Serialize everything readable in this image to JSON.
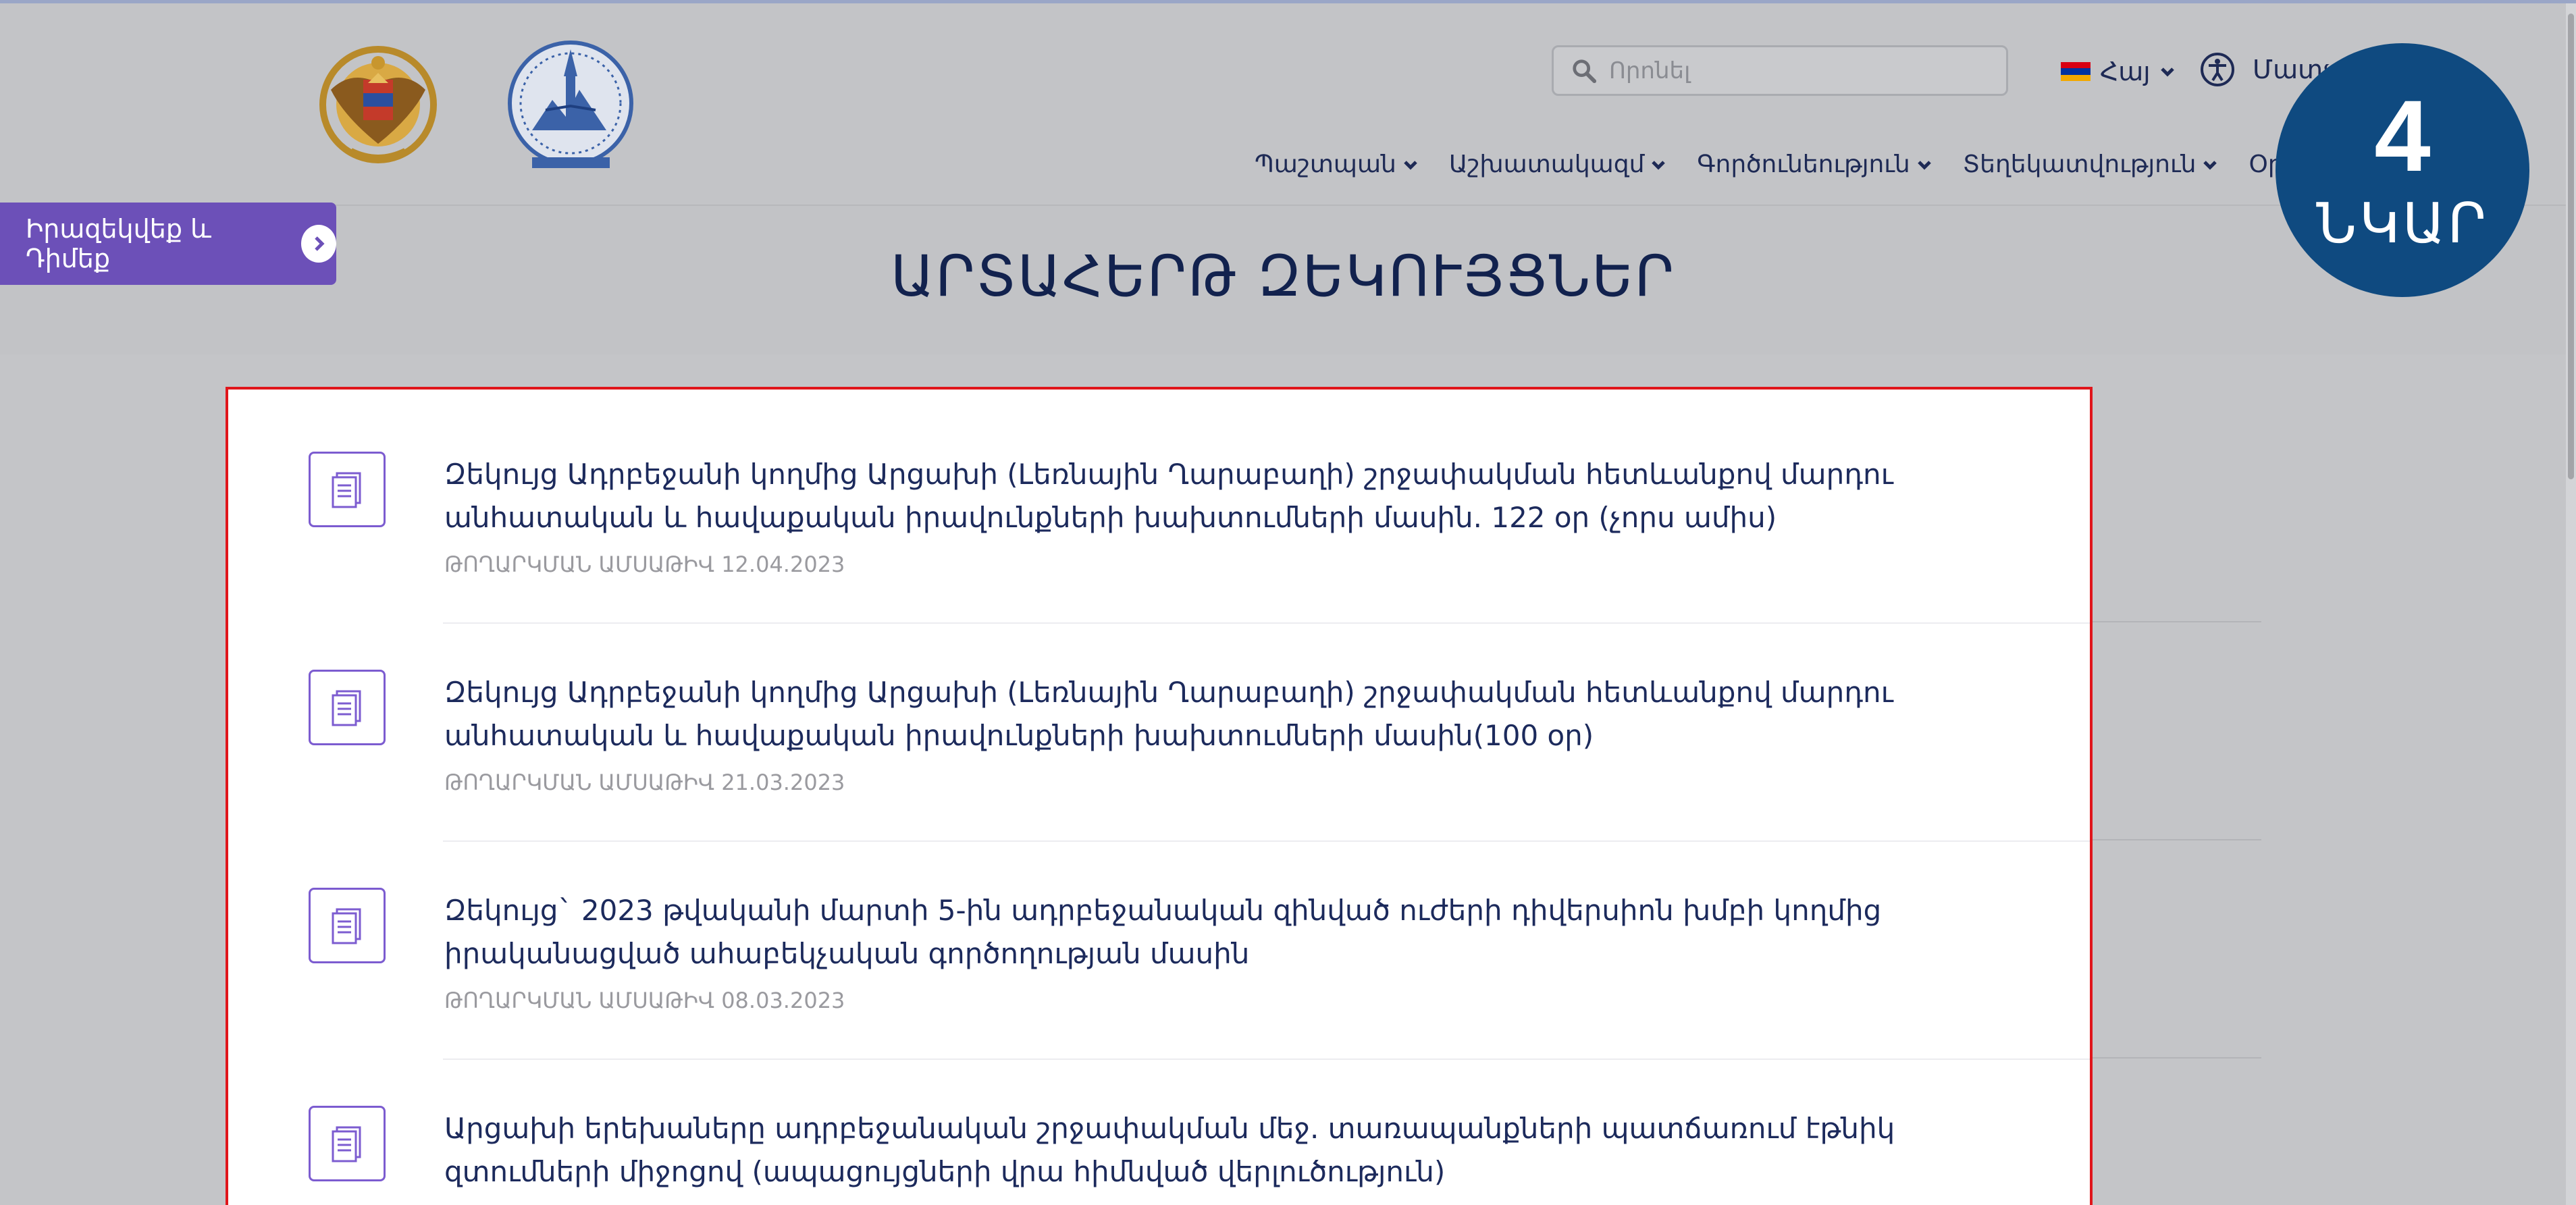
{
  "search": {
    "placeholder": "Որոնել"
  },
  "header": {
    "language": "Հայ",
    "accessibility_label": "Մատչ"
  },
  "nav": [
    {
      "label": "Պաշտպան"
    },
    {
      "label": "Աշխատակազմ"
    },
    {
      "label": "Գործունեություն"
    },
    {
      "label": "Տեղեկատվություն"
    },
    {
      "label": "Օրենսդրութ"
    }
  ],
  "float_button": {
    "label": "Իրազեկվեք և Դիմեք"
  },
  "badge": {
    "number": "4",
    "word": "ՆԿԱՐ"
  },
  "page": {
    "title": "ԱՐՏԱՀԵՐԹ ԶԵԿՈՒՅՑՆԵՐ"
  },
  "items": [
    {
      "title": "Զեկույց Ադրբեջանի կողմից Արցախի (Լեռնային Ղարաբաղի) շրջափակման հետևանքով մարդու անհատական և հավաքական իրավունքների խախտումների մասին. 122 օր (չորս ամիս)",
      "date": "ԹՈՂԱՐԿՄԱՆ ԱՄՍԱԹԻՎ 12.04.2023"
    },
    {
      "title": "Զեկույց Ադրբեջանի կողմից Արցախի (Լեռնային Ղարաբաղի) շրջափակման հետևանքով մարդու անհատական և հավաքական իրավունքների խախտումների մասին(100 օր)",
      "date": "ԹՈՂԱՐԿՄԱՆ ԱՄՍԱԹԻՎ 21.03.2023"
    },
    {
      "title": "Զեկույց` 2023 թվականի մարտի 5-ին ադրբեջանական զինված ուժերի դիվերսիոն խմբի կողմից իրականացված ահաբեկչական գործողության մասին",
      "date": "ԹՈՂԱՐԿՄԱՆ ԱՄՍԱԹԻՎ 08.03.2023"
    },
    {
      "title": "Արցախի երեխաները ադրբեջանական շրջափակման մեջ. տառապանքների պատճառում էթնիկ զտումների միջոցով (ապացույցների վրա հիմնված վերլուծություն)",
      "date": ""
    }
  ],
  "colors": {
    "accent_purple": "#6c50b8",
    "badge_blue": "#0f4a80",
    "frame_red": "#e0161b",
    "text_navy": "#1c2a5c"
  }
}
